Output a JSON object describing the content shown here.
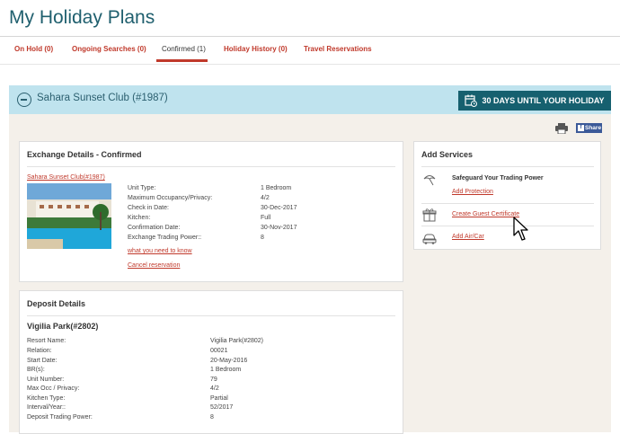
{
  "page": {
    "title": "My Holiday Plans"
  },
  "tabs": [
    {
      "label": "On Hold (0)",
      "active": false
    },
    {
      "label": "Ongoing Searches (0)",
      "active": false
    },
    {
      "label": "Confirmed (1)",
      "active": true
    },
    {
      "label": "Holiday History (0)",
      "active": false
    },
    {
      "label": "Travel Reservations",
      "active": false
    }
  ],
  "club_bar": {
    "name": "Sahara Sunset Club (#1987)",
    "countdown": "30 DAYS UNTIL YOUR HOLIDAY"
  },
  "toolbar": {
    "share_label": "Share",
    "share_logo": "f"
  },
  "exchange": {
    "title": "Exchange Details - Confirmed",
    "resort_link": "Sahara Sunset Club(#1987)",
    "fields": [
      {
        "label": "Unit Type:",
        "value": "1 Bedroom"
      },
      {
        "label": "Maximum Occupancy/Privacy:",
        "value": "4/2"
      },
      {
        "label": "Check in Date:",
        "value": "30-Dec-2017"
      },
      {
        "label": "Kitchen:",
        "value": "Full"
      },
      {
        "label": "Confirmation Date:",
        "value": "30-Nov-2017"
      },
      {
        "label": "Exchange Trading Power::",
        "value": "8"
      }
    ],
    "info_link": "what you need to know",
    "cancel_link": "Cancel reservation"
  },
  "services": {
    "title": "Add Services",
    "items": [
      {
        "icon": "umbrella-icon",
        "heading": "Safeguard Your Trading Power",
        "link": "Add Protection"
      },
      {
        "icon": "gift-icon",
        "heading": "",
        "link": "Create Guest Certificate"
      },
      {
        "icon": "car-icon",
        "heading": "",
        "link": "Add Air/Car"
      }
    ]
  },
  "deposit": {
    "title": "Deposit Details",
    "name": "Vigilia Park(#2802)",
    "fields": [
      {
        "label": "Resort Name:",
        "value": "Vigilia Park(#2802)"
      },
      {
        "label": "Relation:",
        "value": "00021"
      },
      {
        "label": "Start Date:",
        "value": "20-May-2016"
      },
      {
        "label": "BR(s):",
        "value": "1 Bedroom"
      },
      {
        "label": "Unit Number:",
        "value": "79"
      },
      {
        "label": "Max Occ / Privacy:",
        "value": "4/2"
      },
      {
        "label": "Kitchen Type:",
        "value": "Partial"
      },
      {
        "label": "Interval/Year::",
        "value": "52/2017"
      },
      {
        "label": "Deposit Trading Power:",
        "value": "8"
      }
    ]
  },
  "colors": {
    "accent": "#c0392b",
    "teal": "#16606f",
    "bar": "#bfe3ee",
    "panel": "#f4f0ea"
  }
}
